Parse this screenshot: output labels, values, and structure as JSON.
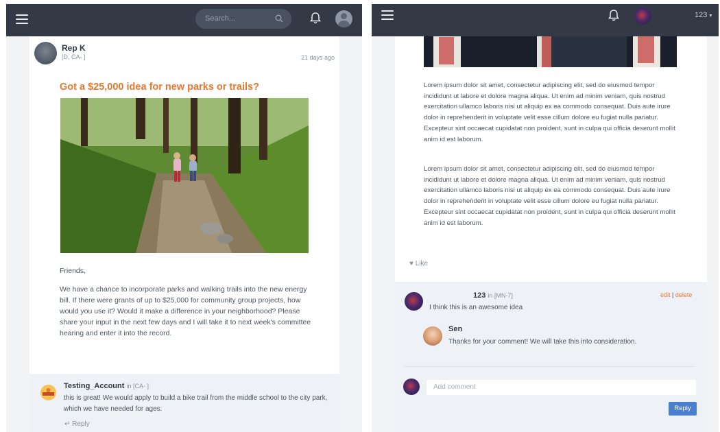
{
  "left_screen": {
    "topbar": {
      "search_placeholder": "Search..."
    },
    "post": {
      "author_name": "Rep K",
      "author_district": "[D, CA-   ]",
      "posted_ago": "21 days ago",
      "title": "Got a $25,000 idea for new parks or trails?",
      "greeting": "Friends,",
      "body": "We have a chance to incorporate parks and walking trails into the new energy bill. If there were grants of up to $25,000 for community group projects, how would you use it? Would it make a difference in your neighborhood? Please share your input in the next few days and I will take it to next week's committee hearing and enter it into the record."
    },
    "comment": {
      "author": "Testing_Account",
      "location": "in [CA-   ]",
      "text": "this is great! We would apply to build a bike trail from the middle school to the city park, which we have needed for ages.",
      "reply_label": "Reply"
    }
  },
  "right_screen": {
    "topbar": {
      "username": "123"
    },
    "paragraphs": [
      "Lorem ipsum dolor sit amet, consectetur adipiscing elit, sed do eiusmod tempor incididunt ut labore et dolore magna aliqua. Ut enim ad minim veniam, quis nostrud exercitation ullamco laboris nisi ut aliquip ex ea commodo consequat. Duis aute irure dolor in reprehenderit in voluptate velit esse cillum dolore eu fugiat nulla pariatur. Excepteur sint occaecat cupidatat non proident, sunt in culpa qui officia deserunt mollit anim id est laborum.",
      "Lorem ipsum dolor sit amet, consectetur adipiscing elit, sed do eiusmod tempor incididunt ut labore et dolore magna aliqua. Ut enim ad minim veniam, quis nostrud exercitation ullamco laboris nisi ut aliquip ex ea commodo consequat. Duis aute irure dolor in reprehenderit in voluptate velit esse cillum dolore eu fugiat nulla pariatur. Excepteur sint occaecat cupidatat non proident, sunt in culpa qui officia deserunt mollit anim id est laborum."
    ],
    "like_label": "Like",
    "comment": {
      "author": "123",
      "location": "in [MN-7]",
      "edit_label": "edit",
      "separator": "|",
      "delete_label": "delete",
      "text": "I think this is an awesome idea"
    },
    "reply": {
      "author": "Sen",
      "text": "Thanks for your comment! We will take this into consideration."
    },
    "add_comment_placeholder": "Add comment",
    "reply_button": "Reply"
  },
  "colors": {
    "topbar": "#333a46",
    "accent_orange": "#e8772e",
    "reply_button": "#4a7fd0",
    "comment_bg": "#eef1f5"
  }
}
